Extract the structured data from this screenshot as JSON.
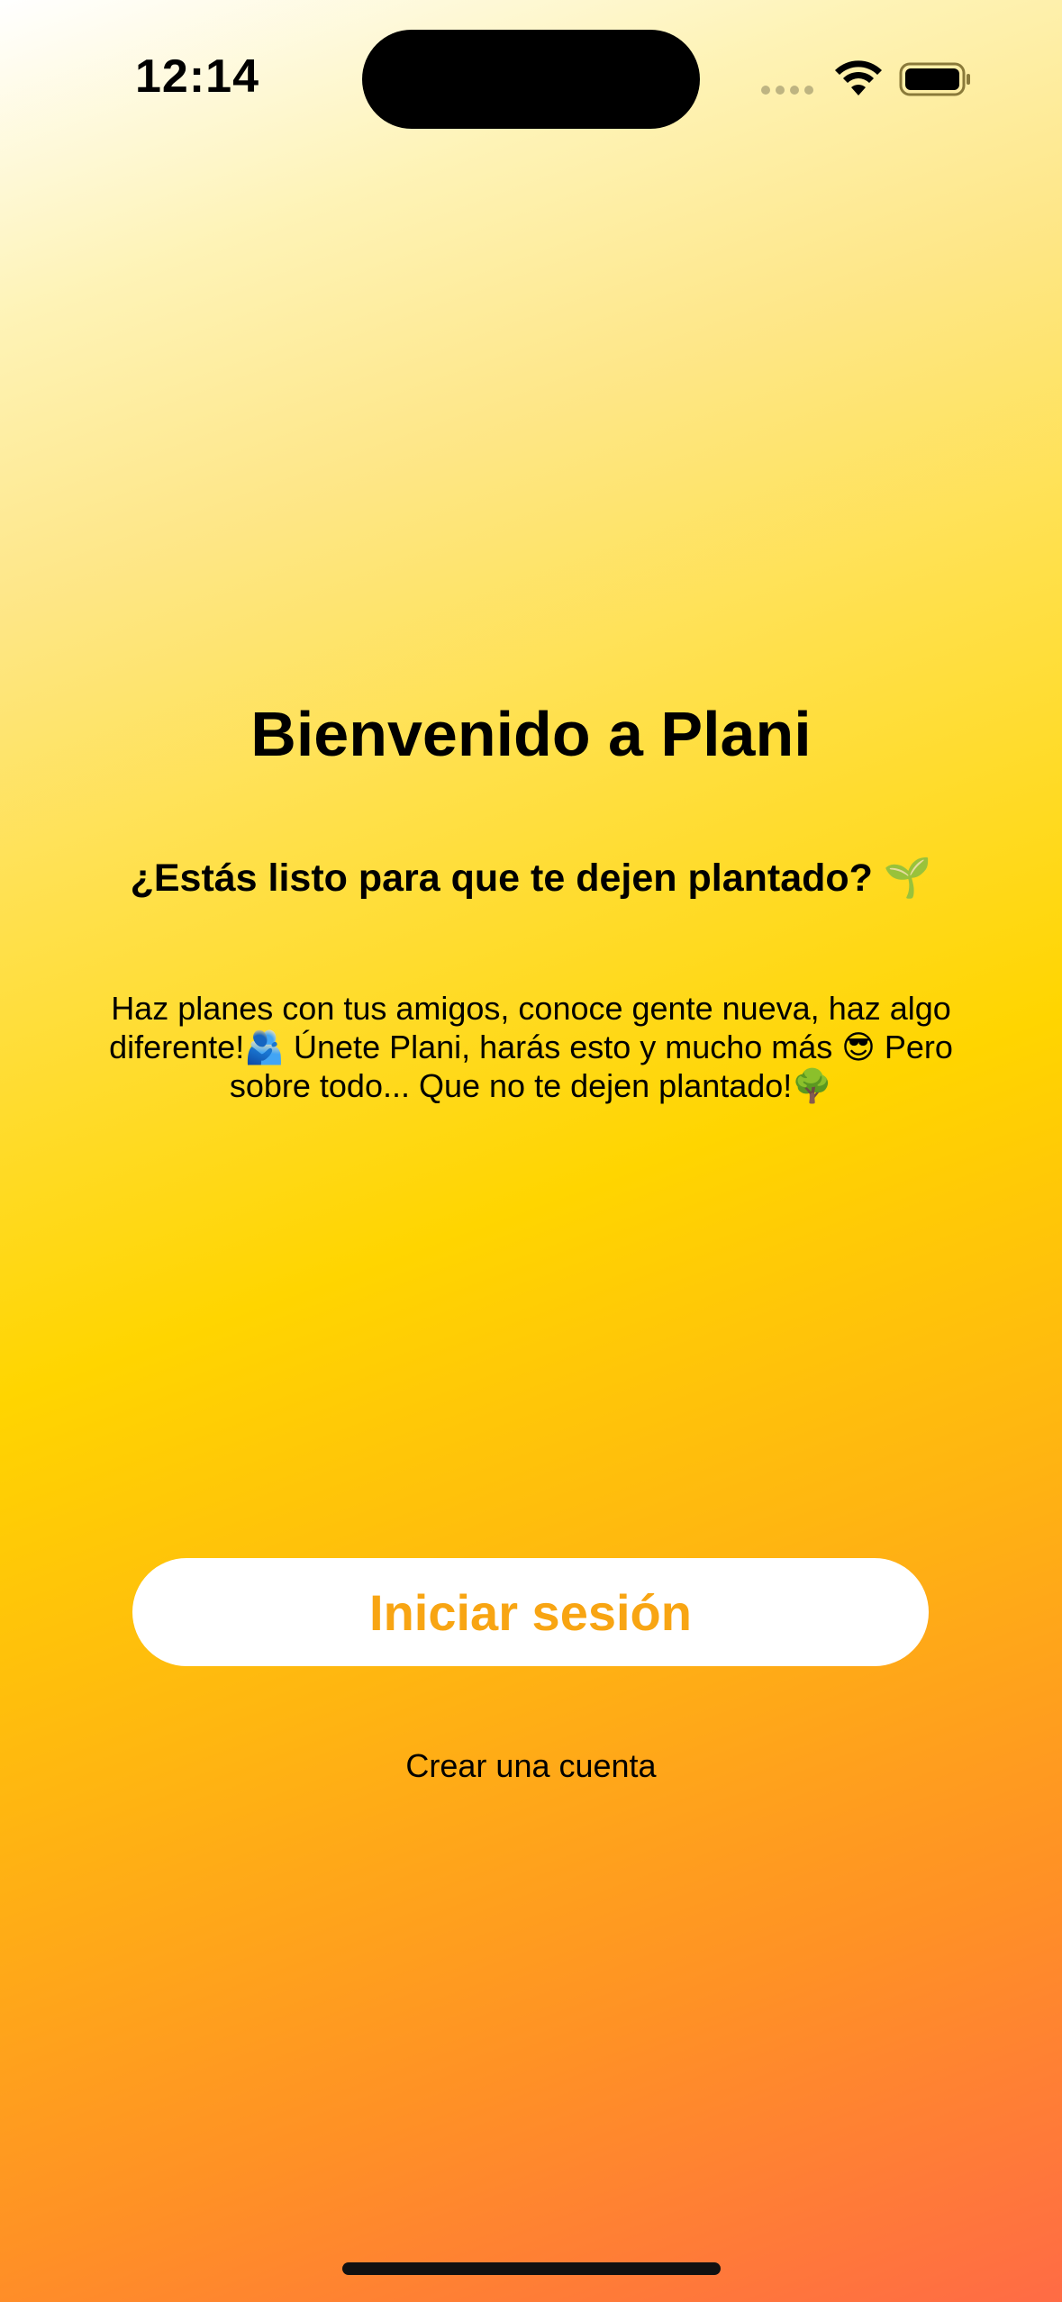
{
  "status_bar": {
    "time": "12:14"
  },
  "welcome": {
    "title": "Bienvenido a Plani",
    "subtitle": "¿Estás listo para que te dejen plantado? 🌱",
    "description": "Haz planes con tus amigos, conoce gente nueva, haz algo diferente!🫂 Únete Plani, harás esto y mucho más 😎 Pero sobre todo... Que no te dejen plantado!🌳"
  },
  "actions": {
    "login_label": "Iniciar sesión",
    "create_account_label": "Crear una cuenta"
  },
  "colors": {
    "accent": "#f8a513",
    "gradient_top": "#ffffff",
    "gradient_mid": "#ffd500",
    "gradient_bottom": "#ff6b45"
  }
}
